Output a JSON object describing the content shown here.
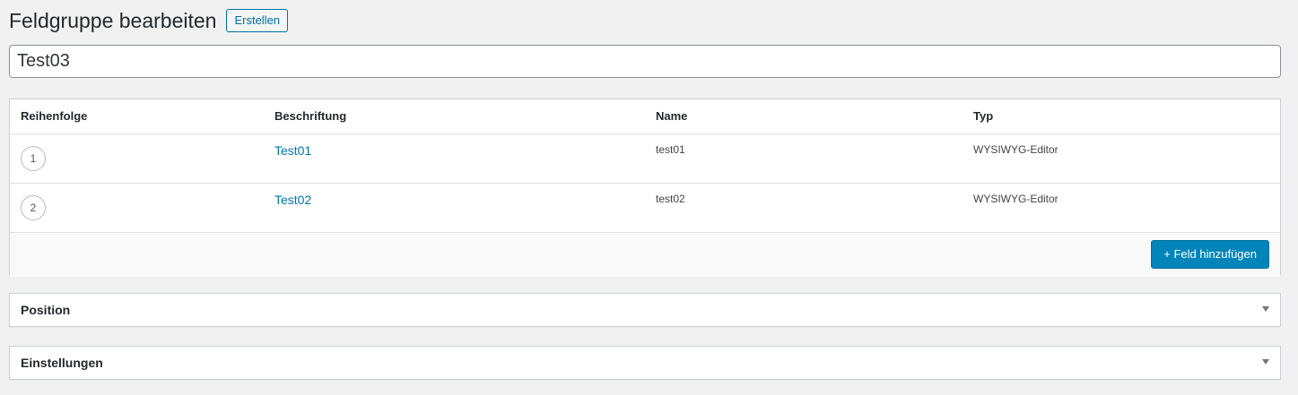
{
  "header": {
    "title": "Feldgruppe bearbeiten",
    "create_label": "Erstellen"
  },
  "title_field": {
    "value": "Test03"
  },
  "fields_table": {
    "columns": [
      "Reihenfolge",
      "Beschriftung",
      "Name",
      "Typ"
    ],
    "rows": [
      {
        "order": "1",
        "label": "Test01",
        "name": "test01",
        "type": "WYSIWYG-Editor"
      },
      {
        "order": "2",
        "label": "Test02",
        "name": "test02",
        "type": "WYSIWYG-Editor"
      }
    ],
    "add_button_label": "+ Feld hinzufügen"
  },
  "postboxes": {
    "position": {
      "title": "Position",
      "icon": "triangle-down-icon"
    },
    "settings": {
      "title": "Einstellungen",
      "icon": "triangle-down-icon"
    }
  },
  "colors": {
    "accent": "#0085ba",
    "link": "#0073aa",
    "background": "#f1f1f1"
  }
}
